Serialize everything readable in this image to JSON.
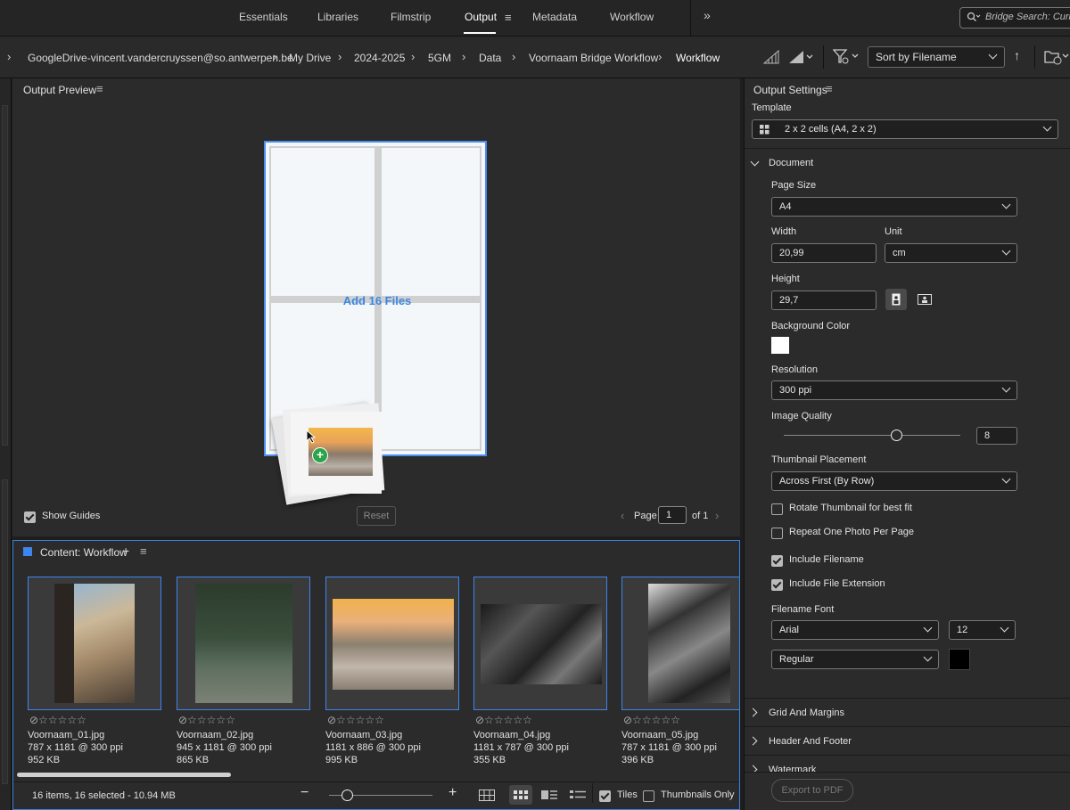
{
  "workspaces": [
    "Essentials",
    "Libraries",
    "Filmstrip",
    "Output",
    "Metadata",
    "Workflow"
  ],
  "active_workspace": "Output",
  "search": {
    "placeholder": "Bridge Search: Curren"
  },
  "breadcrumb": [
    "GoogleDrive-vincent.vandercruyssen@so.antwerpen.be",
    "My Drive",
    "2024-2025",
    "5GM",
    "Data",
    "Voornaam Bridge Workflow",
    "Workflow"
  ],
  "sort": {
    "label": "Sort by Filename"
  },
  "preview": {
    "title": "Output Preview",
    "drop_hint": "Add 16 Files",
    "show_guides": "Show Guides",
    "reset": "Reset",
    "page_label": "Page",
    "page_value": "1",
    "page_of": "of 1"
  },
  "content": {
    "title": "Content: Workflow",
    "items": [
      {
        "name": "Voornaam_01.jpg",
        "dims": "787 x 1181 @ 300 ppi",
        "size": "952 KB"
      },
      {
        "name": "Voornaam_02.jpg",
        "dims": "945 x 1181 @ 300 ppi",
        "size": "865 KB"
      },
      {
        "name": "Voornaam_03.jpg",
        "dims": "1181 x 886 @ 300 ppi",
        "size": "995 KB"
      },
      {
        "name": "Voornaam_04.jpg",
        "dims": "1181 x 787 @ 300 ppi",
        "size": "355 KB"
      },
      {
        "name": "Voornaam_05.jpg",
        "dims": "787 x 1181 @ 300 ppi",
        "size": "396 KB"
      }
    ],
    "status": "16 items, 16 selected - 10.94 MB",
    "tiles": "Tiles",
    "thumbnails_only": "Thumbnails Only"
  },
  "settings": {
    "title": "Output Settings",
    "template_label": "Template",
    "template_value": "2 x 2 cells (A4, 2 x 2)",
    "document_section": "Document",
    "page_size_label": "Page Size",
    "page_size_value": "A4",
    "width_label": "Width",
    "width_value": "20,99",
    "unit_label": "Unit",
    "unit_value": "cm",
    "height_label": "Height",
    "height_value": "29,7",
    "bg_color_label": "Background Color",
    "bg_color": "#ffffff",
    "resolution_label": "Resolution",
    "resolution_value": "300 ppi",
    "quality_label": "Image Quality",
    "quality_value": "8",
    "placement_label": "Thumbnail Placement",
    "placement_value": "Across First (By Row)",
    "rotate_label": "Rotate Thumbnail for best fit",
    "repeat_label": "Repeat One Photo Per Page",
    "include_filename_label": "Include Filename",
    "include_ext_label": "Include File Extension",
    "font_label": "Filename Font",
    "font_value": "Arial",
    "font_size_value": "12",
    "font_style_value": "Regular",
    "font_color": "#000000",
    "grid_section": "Grid And Margins",
    "header_section": "Header And Footer",
    "watermark_section": "Watermark",
    "export_label": "Export to PDF"
  }
}
